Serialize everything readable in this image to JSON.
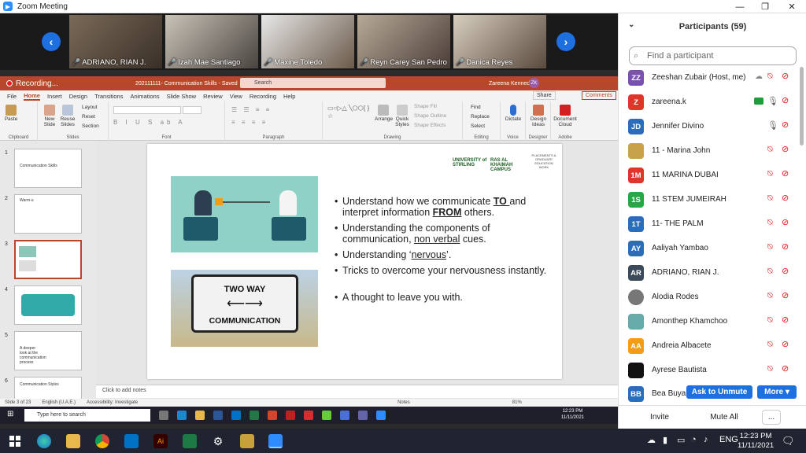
{
  "window": {
    "title": "Zoom Meeting"
  },
  "videos": [
    {
      "name": "ADRIANO, RIAN J."
    },
    {
      "name": "Izah Mae Santiago"
    },
    {
      "name": "Maxine Toledo"
    },
    {
      "name": "Reyn Carey San Pedro"
    },
    {
      "name": "Danica Reyes"
    }
  ],
  "ppt": {
    "recording": "Recording...",
    "doc_title": "202111111- Communication Skills - Saved",
    "search": "Search",
    "user": "Zareena Kennedy",
    "avatar": "ZK",
    "tabs": [
      "File",
      "Home",
      "Insert",
      "Design",
      "Transitions",
      "Animations",
      "Slide Show",
      "Review",
      "View",
      "Recording",
      "Help"
    ],
    "share": "Share",
    "comments": "Comments",
    "groups": {
      "clipboard": "Clipboard",
      "slides": "Slides",
      "font": "Font",
      "paragraph": "Paragraph",
      "drawing": "Drawing",
      "editing": "Editing",
      "voice": "Voice",
      "designer": "Designer",
      "adobe": "Adobe"
    },
    "ribbon": {
      "paste": "Paste",
      "new_slide": "New Slide",
      "reuse": "Reuse Slides",
      "layout": "Layout",
      "reset": "Reset",
      "section": "Section",
      "arrange": "Arrange",
      "quick_styles": "Quick Styles",
      "shape_fill": "Shape Fill",
      "shape_outline": "Shape Outline",
      "shape_effects": "Shape Effects",
      "find": "Find",
      "replace": "Replace",
      "select": "Select",
      "dictate": "Dictate",
      "design_ideas": "Design Ideas",
      "document_cloud": "Document Cloud"
    },
    "thumbs": [
      {
        "num": "1",
        "text": "Communication Skills"
      },
      {
        "num": "2",
        "text": "Warm-u"
      },
      {
        "num": "3",
        "text": ""
      },
      {
        "num": "4",
        "text": ""
      },
      {
        "num": "5",
        "text": "A deeper look at the communication process"
      },
      {
        "num": "6",
        "text": "Communication Styles"
      }
    ],
    "slide": {
      "logo1": "UNIVERSITY of STIRLING",
      "logo2": "RAS AL KHAIMAH CAMPUS",
      "logo3": "PLACEMENTS & GRADUATE EDUCATION WORK",
      "sign_top": "TWO WAY",
      "sign_bottom": "COMMUNICATION",
      "b1a": "Understand how we communicate ",
      "b1b": "TO ",
      "b1c": "and interpret information ",
      "b1d": "FROM",
      "b1e": " others.",
      "b2a": "Understanding the components of communication, ",
      "b2b": "non verbal",
      "b2c": " cues.",
      "b3a": "Understanding ‘",
      "b3b": "nervous",
      "b3c": "’.",
      "b4": "Tricks to overcome your nervousness instantly.",
      "b5": "A thought to leave you with."
    },
    "notes": "Click to add notes",
    "status": {
      "slide": "Slide 3 of 23",
      "lang": "English (U.A.E.)",
      "access": "Accessibility: Investigate",
      "notes": "Notes",
      "zoom": "81%"
    },
    "taskbar": {
      "search": "Type here to search",
      "time": "12:23 PM",
      "date": "11/11/2021"
    }
  },
  "participants": {
    "header": "Participants (59)",
    "search_placeholder": "Find a participant",
    "list": [
      {
        "initials": "ZZ",
        "name": "Zeeshan Zubair (Host, me)",
        "color": "#7b52ab"
      },
      {
        "initials": "Z",
        "name": "zareena.k",
        "color": "#e0352b"
      },
      {
        "initials": "JD",
        "name": "Jennifer Divino",
        "color": "#2a6ebb"
      },
      {
        "initials": "",
        "name": "11 - Marina John",
        "color": "#c8a24a"
      },
      {
        "initials": "1M",
        "name": "11 MARINA DUBAI",
        "color": "#e0352b"
      },
      {
        "initials": "1S",
        "name": "11 STEM JUMEIRAH",
        "color": "#27a745"
      },
      {
        "initials": "1T",
        "name": "11- THE PALM",
        "color": "#2a6ebb"
      },
      {
        "initials": "AY",
        "name": "Aaliyah Yambao",
        "color": "#2a6ebb"
      },
      {
        "initials": "AR",
        "name": "ADRIANO, RIAN J.",
        "color": "#3a4a5a"
      },
      {
        "initials": "",
        "name": "Alodia Rodes",
        "color": "#777777"
      },
      {
        "initials": "",
        "name": "Amonthep Khamchoo",
        "color": "#6aa"
      },
      {
        "initials": "AA",
        "name": "Andreia Albacete",
        "color": "#f39c12"
      },
      {
        "initials": "",
        "name": "Ayrese Bautista",
        "color": "#111111"
      },
      {
        "initials": "BB",
        "name": "Bea Buya",
        "color": "#2a6ebb"
      }
    ],
    "ask_unmute": "Ask to Unmute",
    "more": "More",
    "invite": "Invite",
    "mute_all": "Mute All",
    "dots": "..."
  },
  "taskbar": {
    "time": "12:23 PM",
    "date": "11/11/2021"
  }
}
